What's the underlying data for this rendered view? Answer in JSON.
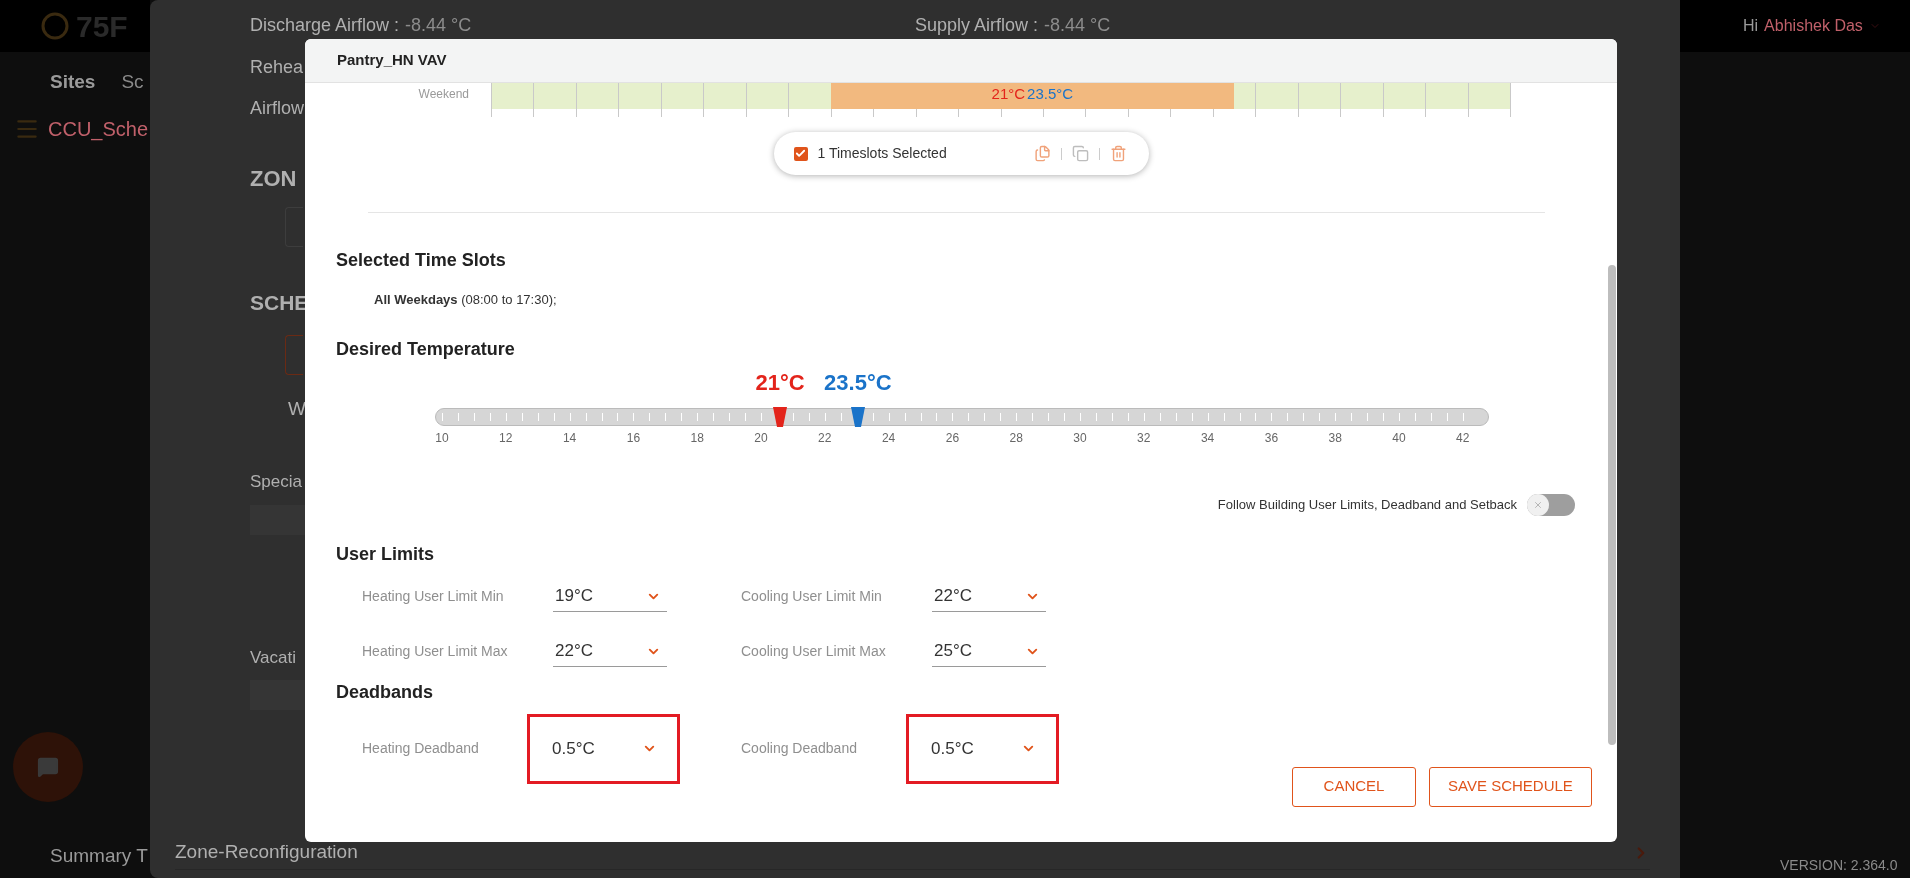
{
  "background": {
    "logo": "75F",
    "nav": [
      {
        "label": "Sites",
        "selected": true
      },
      {
        "label": "Sc",
        "selected": false
      }
    ],
    "breadcrumb": "CCU_Sche",
    "summary": "Summary T",
    "greeting": "Hi",
    "user": "Abhishek Das",
    "version": "VERSION: 2.364.0",
    "panel": {
      "readings": [
        {
          "label": "Discharge Airflow :",
          "value": "-8.44 °C"
        },
        {
          "label": "Supply Airflow :",
          "value": "-8.44 °C"
        }
      ],
      "lines": [
        "Rehea",
        "Airflow"
      ],
      "zone_heading": "ZON",
      "schedule_heading": "SCHE",
      "schedule_tab": "W",
      "special_heading": "Specia",
      "vacation_heading": "Vacati",
      "accordion": "Zone-Reconfiguration"
    }
  },
  "modal": {
    "title": "Pantry_HN VAV",
    "schedule_row": {
      "label": "Weekend",
      "slot": {
        "heating": "21°C",
        "cooling": "23.5°C"
      }
    },
    "selection": {
      "checked": true,
      "label": "1 Timeslots Selected"
    },
    "selected_slots": {
      "heading": "Selected Time Slots",
      "entries": [
        "**All Weekdays** (08:00 to 17:30);"
      ]
    },
    "desired_temperature": {
      "heading": "Desired Temperature",
      "heating": {
        "reading": "21°C",
        "level": 0.327
      },
      "cooling": {
        "reading": "23.5°C",
        "level": 0.401
      },
      "scale": [
        "10",
        "12",
        "14",
        "16",
        "18",
        "20",
        "22",
        "24",
        "26",
        "28",
        "30",
        "32",
        "34",
        "36",
        "38",
        "40",
        "42"
      ]
    },
    "follow_toggle": {
      "label": "Follow Building User Limits, Deadband and Setback",
      "on": false
    },
    "user_limits": {
      "heading": "User Limits",
      "fields": [
        {
          "label": "Heating User Limit Min",
          "value": "19°C",
          "highlighted": false
        },
        {
          "label": "Cooling User Limit Min",
          "value": "22°C",
          "highlighted": false
        },
        {
          "label": "Heating User Limit Max",
          "value": "22°C",
          "highlighted": false
        },
        {
          "label": "Cooling User Limit Max",
          "value": "25°C",
          "highlighted": false
        }
      ]
    },
    "deadbands": {
      "heading": "Deadbands",
      "fields": [
        {
          "label": "Heating Deadband",
          "value": "0.5°C",
          "highlighted": true
        },
        {
          "label": "Cooling Deadband",
          "value": "0.5°C",
          "highlighted": true
        }
      ]
    },
    "buttons": [
      "CANCEL",
      "SAVE SCHEDULE"
    ]
  }
}
